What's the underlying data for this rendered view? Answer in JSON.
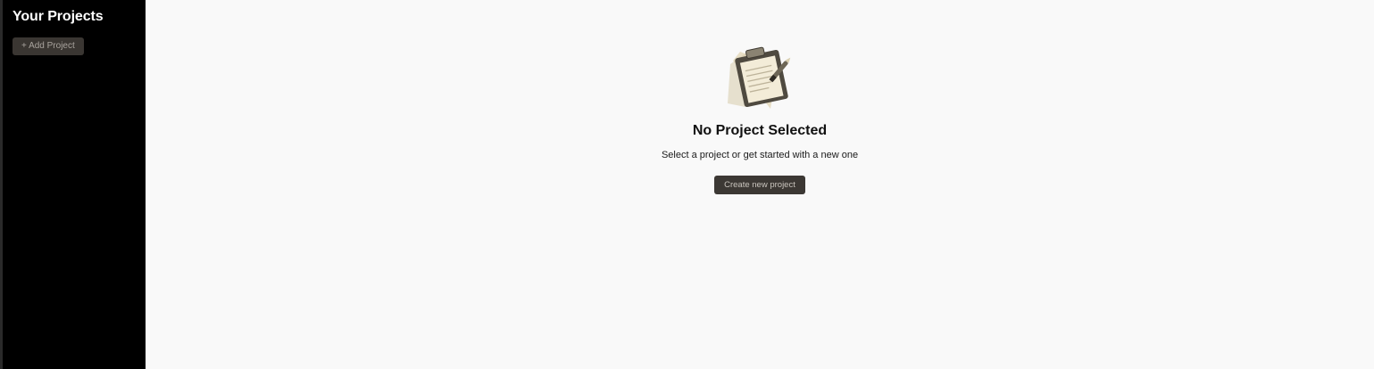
{
  "sidebar": {
    "title": "Your Projects",
    "add_project_label": "+ Add Project"
  },
  "main": {
    "empty_state": {
      "icon": "clipboard-icon",
      "title": "No Project Selected",
      "subtitle": "Select a project or get started with a new one",
      "create_button_label": "Create new project"
    }
  },
  "colors": {
    "sidebar_bg": "#000000",
    "main_bg": "#f9f9f9",
    "button_bg": "#3c3834",
    "button_text": "#c9c4bd"
  }
}
